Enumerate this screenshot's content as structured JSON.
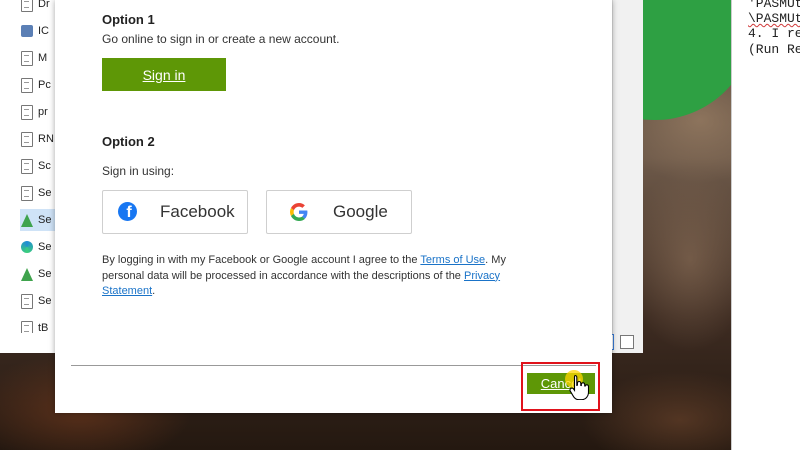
{
  "file_list": {
    "items": [
      {
        "label": "Dr",
        "icon": "document-icon"
      },
      {
        "label": "IC",
        "icon": "app-icon"
      },
      {
        "label": "M",
        "icon": "document-icon"
      },
      {
        "label": "Pc",
        "icon": "document-icon"
      },
      {
        "label": "pr",
        "icon": "document-icon"
      },
      {
        "label": "RN",
        "icon": "document-icon"
      },
      {
        "label": "Sc",
        "icon": "document-icon"
      },
      {
        "label": "Se",
        "icon": "document-icon"
      },
      {
        "label": "Se",
        "icon": "tree-icon"
      },
      {
        "label": "Se",
        "icon": "edge-icon"
      },
      {
        "label": "Se",
        "icon": "tree-icon"
      },
      {
        "label": "Se",
        "icon": "document-icon"
      },
      {
        "label": "tB",
        "icon": "document-icon"
      }
    ]
  },
  "editor": {
    "lines": [
      "'PASMUt",
      "\\PASMUt",
      "4. I re",
      "(Run Re"
    ]
  },
  "dialog": {
    "option1_heading": "Option 1",
    "option1_text": "Go online to sign in or create a new account.",
    "signin_label": "Sign in",
    "option2_heading": "Option 2",
    "option2_text": "Sign in using:",
    "facebook_label": "Facebook",
    "google_label": "Google",
    "legal": {
      "part1": "By logging in with my Facebook or Google account I agree to the ",
      "terms_link": "Terms of Use",
      "part2": ". My personal data will be processed in accordance with the descriptions of the ",
      "privacy_link": "Privacy Statement",
      "part3": "."
    },
    "cancel_label": "Cancel"
  },
  "colors": {
    "accent_green": "#5e9706",
    "facebook_blue": "#1877f2",
    "link_blue": "#1a73c8",
    "highlight_red": "#e0121b"
  }
}
